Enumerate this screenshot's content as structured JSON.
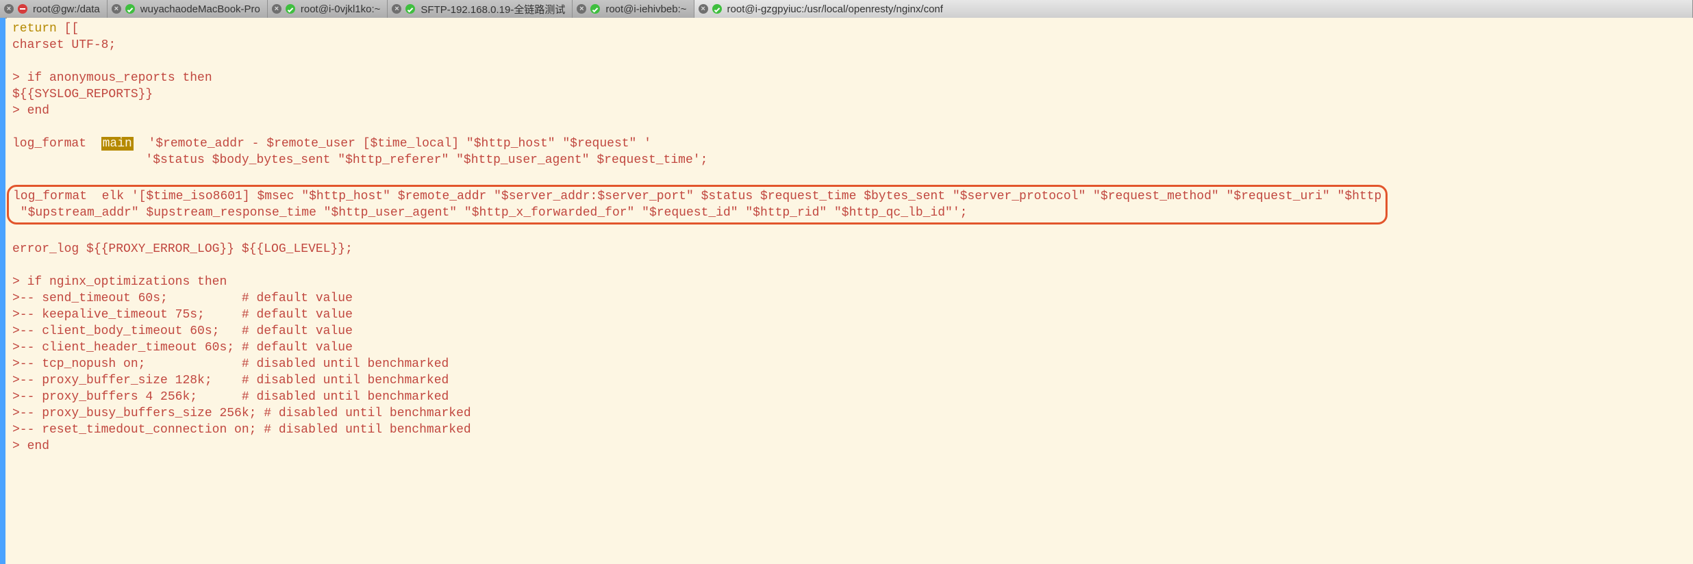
{
  "tabs": [
    {
      "status": "red",
      "label": "root@gw:/data"
    },
    {
      "status": "green",
      "label": "wuyachaodeMacBook-Pro"
    },
    {
      "status": "green",
      "label": "root@i-0vjkl1ko:~"
    },
    {
      "status": "green",
      "label": "SFTP-192.168.0.19-全链路测试"
    },
    {
      "status": "green",
      "label": "root@i-iehivbeb:~"
    },
    {
      "status": "green",
      "label": "root@i-gzgpyiuc:/usr/local/openresty/nginx/conf",
      "active": true
    }
  ],
  "code": {
    "l1a": "return",
    "l1b": " [[",
    "l2": "charset UTF-8;",
    "l3": "",
    "l4": "> if anonymous_reports then",
    "l5": "${{SYSLOG_REPORTS}}",
    "l6": "> end",
    "l7": "",
    "l8a": "log_format  ",
    "l8b": "main",
    "l8c": "  '$remote_addr - $remote_user [$time_local] \"$http_host\" \"$request\" '",
    "l9": "                  '$status $body_bytes_sent \"$http_referer\" \"$http_user_agent\" $request_time';",
    "l10": "",
    "l11": "log_format  elk '[$time_iso8601] $msec \"$http_host\" $remote_addr \"$server_addr:$server_port\" $status $request_time $bytes_sent \"$server_protocol\" \"$request_method\" \"$request_uri\" \"$http",
    "l12": " \"$upstream_addr\" $upstream_response_time \"$http_user_agent\" \"$http_x_forwarded_for\" \"$request_id\" \"$http_rid\" \"$http_qc_lb_id\"';",
    "l13": "",
    "l14": "error_log ${{PROXY_ERROR_LOG}} ${{LOG_LEVEL}};",
    "l15": "",
    "l16": "> if nginx_optimizations then",
    "l17": ">-- send_timeout 60s;          # default value",
    "l18": ">-- keepalive_timeout 75s;     # default value",
    "l19": ">-- client_body_timeout 60s;   # default value",
    "l20": ">-- client_header_timeout 60s; # default value",
    "l21": ">-- tcp_nopush on;             # disabled until benchmarked",
    "l22": ">-- proxy_buffer_size 128k;    # disabled until benchmarked",
    "l23": ">-- proxy_buffers 4 256k;      # disabled until benchmarked",
    "l24": ">-- proxy_busy_buffers_size 256k; # disabled until benchmarked",
    "l25": ">-- reset_timedout_connection on; # disabled until benchmarked",
    "l26": "> end"
  }
}
